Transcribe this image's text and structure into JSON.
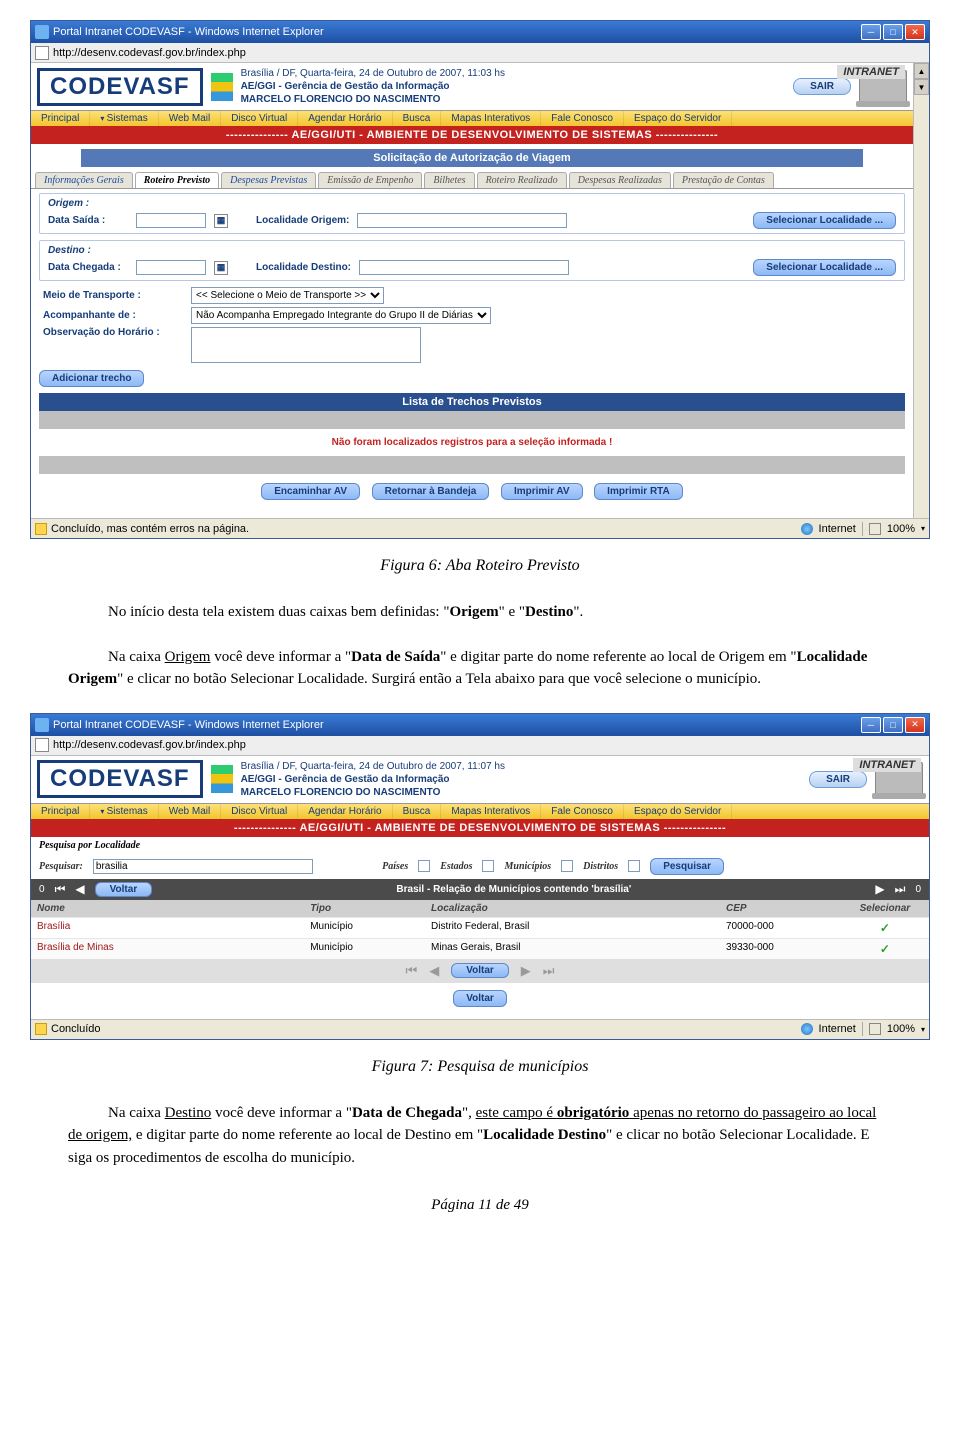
{
  "ie": {
    "title": "Portal Intranet CODEVASF - Windows Internet Explorer",
    "url": "http://desenv.codevasf.gov.br/index.php",
    "status": {
      "text1": "Concluído, mas contém erros na página.",
      "text2": "Concluído",
      "internet": "Internet",
      "zoom": "100%"
    }
  },
  "header": {
    "logo": "CODEVASF",
    "meta_line1a": "Brasília / DF, Quarta-feira, 24 de Outubro de 2007, 11:03 hs",
    "meta_line1b": "Brasília / DF, Quarta-feira, 24 de Outubro de 2007, 11:07 hs",
    "meta_line2": "AE/GGI - Gerência de Gestão da Informação",
    "meta_line3": "MARCELO FLORENCIO DO NASCIMENTO",
    "sair": "SAIR",
    "intranet": "INTRANET"
  },
  "topnav": [
    "Principal",
    "Sistemas",
    "Web Mail",
    "Disco Virtual",
    "Agendar Horário",
    "Busca",
    "Mapas Interativos",
    "Fale Conosco",
    "Espaço do Servidor"
  ],
  "redbanner": "--------------- AE/GGI/UTI - AMBIENTE DE DESENVOLVIMENTO DE SISTEMAS ---------------",
  "fig6": {
    "subheader": "Solicitação de Autorização de Viagem",
    "tabs": [
      "Informações Gerais",
      "Roteiro Previsto",
      "Despesas Previstas",
      "Emissão de Empenho",
      "Bilhetes",
      "Roteiro Realizado",
      "Despesas Realizadas",
      "Prestação de Contas"
    ],
    "origem_title": "Origem :",
    "data_saida_lbl": "Data Saída :",
    "loc_origem_lbl": "Localidade Origem:",
    "destino_title": "Destino :",
    "data_chegada_lbl": "Data Chegada :",
    "loc_destino_lbl": "Localidade Destino:",
    "sel_local_btn": "Selecionar Localidade ...",
    "meio_lbl": "Meio de Transporte :",
    "meio_opt": "<< Selecione o Meio de Transporte >>",
    "acomp_lbl": "Acompanhante de :",
    "acomp_opt": "Não Acompanha Empregado Integrante do Grupo II de Diárias",
    "obs_lbl": "Observação do Horário :",
    "add_trecho": "Adicionar trecho",
    "list_header": "Lista de Trechos Previstos",
    "list_msg": "Não foram localizados registros para a seleção informada !",
    "bottom_btns": [
      "Encaminhar AV",
      "Retornar à Bandeja",
      "Imprimir AV",
      "Imprimir RTA"
    ]
  },
  "fig7": {
    "search_title": "Pesquisa por Localidade",
    "pesquisar_lbl": "Pesquisar:",
    "pesquisar_val": "brasilia",
    "filters": [
      "Países",
      "Estados",
      "Municípios",
      "Distritos"
    ],
    "pesquisar_btn": "Pesquisar",
    "navbar_count": "0",
    "navbar_voltar": "Voltar",
    "navbar_title": "Brasil - Relação de Municípios contendo 'brasília'",
    "columns": [
      "Nome",
      "Tipo",
      "Localização",
      "CEP",
      "Selecionar"
    ],
    "rows": [
      {
        "nome": "Brasília",
        "tipo": "Município",
        "loc": "Distrito Federal, Brasil",
        "cep": "70000-000"
      },
      {
        "nome": "Brasília de Minas",
        "tipo": "Município",
        "loc": "Minas Gerais, Brasil",
        "cep": "39330-000"
      }
    ],
    "voltar_btn": "Voltar"
  },
  "captions": {
    "fig6": "Figura 6: Aba Roteiro Previsto",
    "fig7": "Figura 7: Pesquisa de municípios"
  },
  "para1_parts": {
    "t1": "No início desta tela existem duas caixas bem definidas: \"",
    "t2": "Origem",
    "t3": "\" e \"",
    "t4": "Destino",
    "t5": "\"."
  },
  "para2_parts": {
    "t1": "Na caixa ",
    "t2": "Origem",
    "t3": " você deve informar a \"",
    "t4": "Data de Saída",
    "t5": "\" e digitar parte do nome referente ao local de Origem em \"",
    "t6": "Localidade Origem",
    "t7": "\" e clicar no botão Selecionar Localidade. Surgirá então a Tela abaixo para que você selecione o município."
  },
  "para3_parts": {
    "t1": "Na caixa ",
    "t2": "Destino",
    "t3": " você deve informar a \"",
    "t4": "Data de Chegada",
    "t5": "\", ",
    "t6": "este campo é ",
    "t7": "obrigatório",
    "t8": " apenas no retorno do passageiro ao local de origem,",
    "t9": " e digitar parte do nome referente ao local de Destino em \"",
    "t10": "Localidade Destino",
    "t11": "\" e clicar no botão Selecionar Localidade. E siga os procedimentos de escolha do município."
  },
  "page_num": "Página 11 de 49"
}
